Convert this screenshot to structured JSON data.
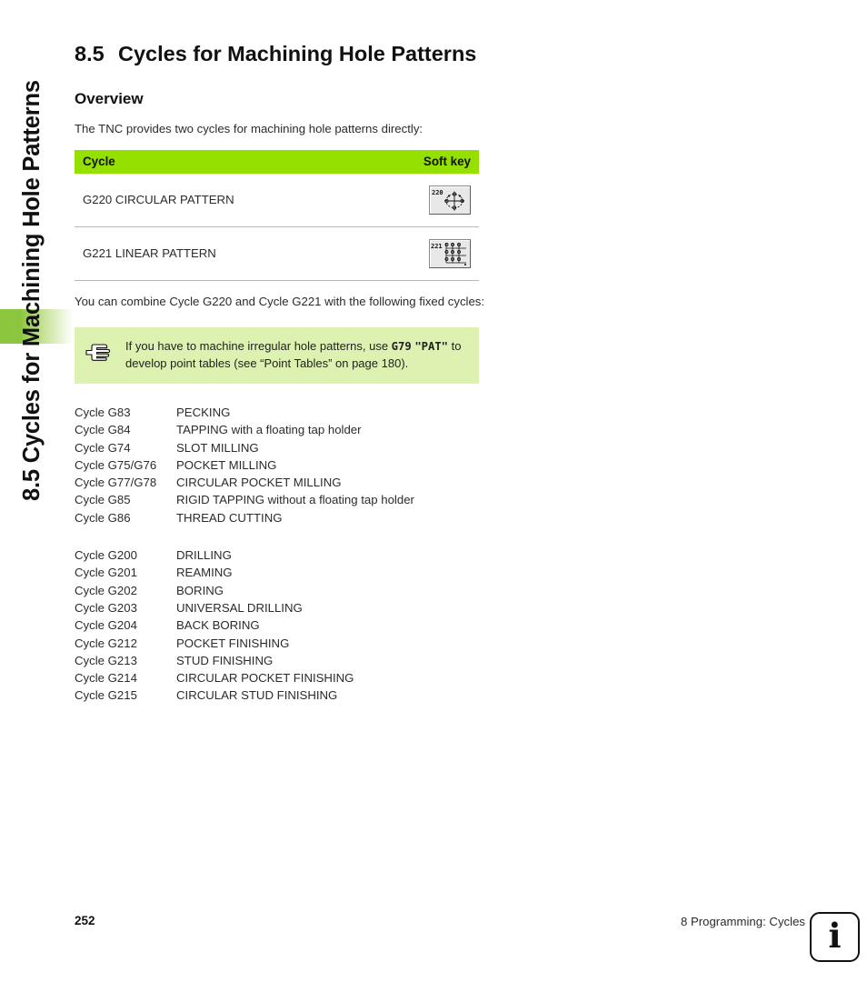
{
  "sidebar": {
    "running_title": "8.5 Cycles for Machining Hole Patterns"
  },
  "section": {
    "number": "8.5",
    "title": "Cycles for Machining Hole Patterns",
    "subheading": "Overview",
    "intro": "The TNC provides two cycles for machining hole patterns directly:"
  },
  "table": {
    "headers": {
      "cycle": "Cycle",
      "softkey": "Soft key"
    },
    "rows": [
      {
        "cycle": "G220 CIRCULAR PATTERN",
        "softkey_label": "220",
        "softkey_icon": "circular-pattern-icon"
      },
      {
        "cycle": "G221 LINEAR PATTERN",
        "softkey_label": "221",
        "softkey_icon": "linear-pattern-icon"
      }
    ]
  },
  "combine_text": "You can combine Cycle G220 and Cycle G221 with the following fixed cycles:",
  "note": {
    "icon": "pointing-hand-icon",
    "text_before": "If you have to machine irregular hole patterns, use ",
    "code1": "G79",
    "code2": "\"PAT\"",
    "text_middle": " to develop point tables (see “Point Tables” on page ",
    "page_ref": "180",
    "text_after": ")."
  },
  "cycle_groups": [
    {
      "items": [
        {
          "code": "Cycle G83",
          "desc": "PECKING"
        },
        {
          "code": "Cycle G84",
          "desc": "TAPPING with a floating tap holder"
        },
        {
          "code": "Cycle G74",
          "desc": "SLOT MILLING"
        },
        {
          "code": "Cycle G75/G76",
          "desc": "POCKET MILLING"
        },
        {
          "code": "Cycle G77/G78",
          "desc": "CIRCULAR POCKET MILLING"
        },
        {
          "code": "Cycle G85",
          "desc": "RIGID TAPPING without a floating tap holder"
        },
        {
          "code": "Cycle G86",
          "desc": "THREAD CUTTING"
        }
      ]
    },
    {
      "items": [
        {
          "code": "Cycle G200",
          "desc": "DRILLING"
        },
        {
          "code": "Cycle G201",
          "desc": "REAMING"
        },
        {
          "code": "Cycle G202",
          "desc": "BORING"
        },
        {
          "code": "Cycle G203",
          "desc": "UNIVERSAL DRILLING"
        },
        {
          "code": "Cycle G204",
          "desc": "BACK BORING"
        },
        {
          "code": "Cycle G212",
          "desc": "POCKET FINISHING"
        },
        {
          "code": "Cycle G213",
          "desc": "STUD FINISHING"
        },
        {
          "code": "Cycle G214",
          "desc": "CIRCULAR POCKET FINISHING"
        },
        {
          "code": "Cycle G215",
          "desc": "CIRCULAR STUD FINISHING"
        }
      ]
    }
  ],
  "footer": {
    "page_number": "252",
    "chapter": "8 Programming: Cycles",
    "info_glyph": "i"
  },
  "colors": {
    "header_green": "#96e000",
    "note_green": "#ddf2b0",
    "marker_green": "#8cc63f"
  }
}
